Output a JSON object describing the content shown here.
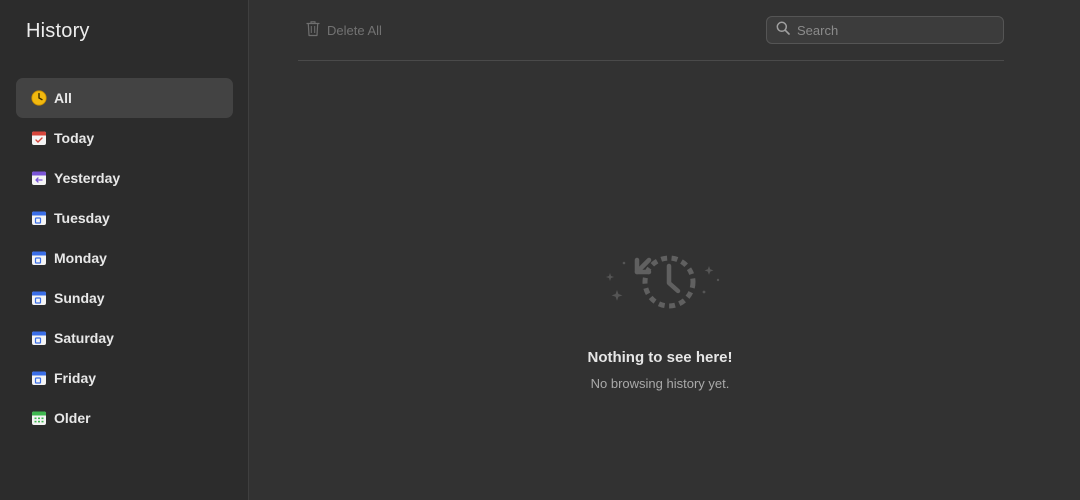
{
  "sidebar": {
    "title": "History",
    "items": [
      {
        "label": "All",
        "icon": "clock-icon"
      },
      {
        "label": "Today",
        "icon": "calendar-today-icon"
      },
      {
        "label": "Yesterday",
        "icon": "calendar-yesterday-icon"
      },
      {
        "label": "Tuesday",
        "icon": "calendar-icon"
      },
      {
        "label": "Monday",
        "icon": "calendar-icon"
      },
      {
        "label": "Sunday",
        "icon": "calendar-icon"
      },
      {
        "label": "Saturday",
        "icon": "calendar-icon"
      },
      {
        "label": "Friday",
        "icon": "calendar-icon"
      },
      {
        "label": "Older",
        "icon": "calendar-older-icon"
      }
    ],
    "selected": "All"
  },
  "toolbar": {
    "delete_all_label": "Delete All",
    "delete_icon": "trash-icon",
    "search_placeholder": "Search",
    "search_value": "",
    "search_icon": "search-icon"
  },
  "empty_state": {
    "icon": "history-clock-icon",
    "title": "Nothing to see here!",
    "subtitle": "No browsing history yet."
  },
  "colors": {
    "background": "#323232",
    "sidebar_background": "#2c2c2c",
    "selected_item": "#434343",
    "clock_yellow": "#f2b90f",
    "calendar_red": "#d6453b",
    "calendar_purple": "#7a55d6",
    "calendar_blue": "#3a6ee6",
    "calendar_green": "#3fb750"
  }
}
